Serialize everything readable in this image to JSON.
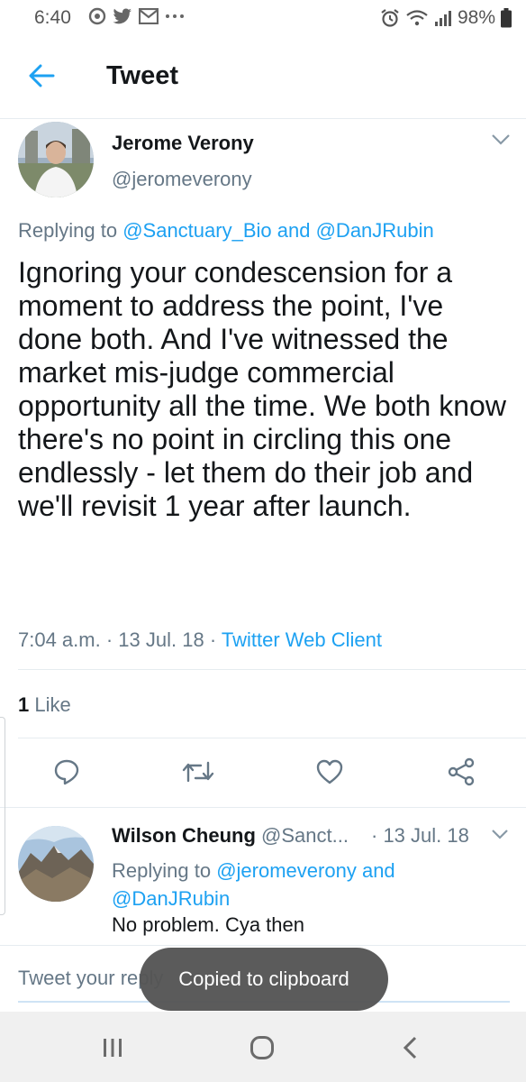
{
  "status_bar": {
    "time": "6:40",
    "battery": "98%",
    "left_icons": [
      "sync-icon",
      "twitter-icon",
      "gmail-icon",
      "more-dots-icon"
    ],
    "right_icons": [
      "alarm-icon",
      "wifi-icon",
      "signal-icon",
      "battery-icon"
    ]
  },
  "header": {
    "title": "Tweet"
  },
  "tweet": {
    "author_name": "Jerome Verony",
    "author_handle": "@jeromeverony",
    "replying_prefix": "Replying to",
    "replying_user1": "@Sanctuary_Bio",
    "replying_and": "and",
    "replying_user2": "@DanJRubin",
    "text": "Ignoring your condescension for a moment to address the point, I've done both. And I've witnessed the market mis-judge commercial opportunity all the time. We both know there's no point in circling this one endlessly - let them do their job and we'll revisit 1 year after launch.",
    "time": "7:04 a.m.",
    "sep": "·",
    "date": "13 Jul. 18",
    "client": "Twitter Web Client",
    "like_count": "1",
    "like_label": "Like"
  },
  "reply": {
    "author_name": "Wilson Cheung",
    "author_handle": "@Sanct...",
    "date": "· 13 Jul. 18",
    "replying_prefix": "Replying to",
    "replying_user1": "@jeromeverony",
    "replying_and": "and",
    "replying_user2": "@DanJRubin",
    "text": "No problem. Cya then"
  },
  "compose": {
    "placeholder": "Tweet your reply"
  },
  "toast": {
    "message": "Copied to clipboard"
  },
  "colors": {
    "accent": "#1da1f2",
    "secondary_text": "#657786",
    "primary_text": "#14171a",
    "toast_bg": "#555555",
    "nav_bg": "#f0f0f0"
  }
}
